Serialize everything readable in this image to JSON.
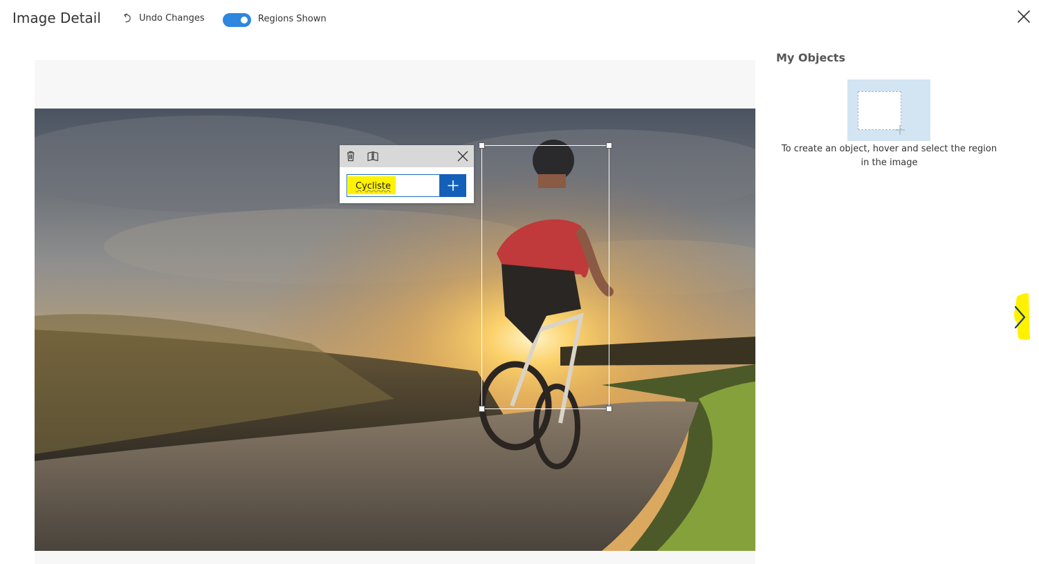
{
  "header": {
    "title": "Image Detail",
    "undo_label": "Undo Changes",
    "toggle_label": "Regions Shown",
    "toggle_on": true
  },
  "region": {
    "tag_value": "Cycliste"
  },
  "objects_panel": {
    "title": "My Objects",
    "hint": "To create an object, hover and select the region in the image"
  },
  "icons": {
    "undo": "undo-icon",
    "close": "close-icon",
    "delete": "trash-icon",
    "split": "split-region-icon",
    "popup_close": "close-icon",
    "add_tag": "plus-icon",
    "next": "chevron-right-icon"
  },
  "colors": {
    "accent": "#2f86de",
    "tag_button": "#1360b8",
    "tile": "#d3e4f2",
    "highlight": "#fff200"
  }
}
